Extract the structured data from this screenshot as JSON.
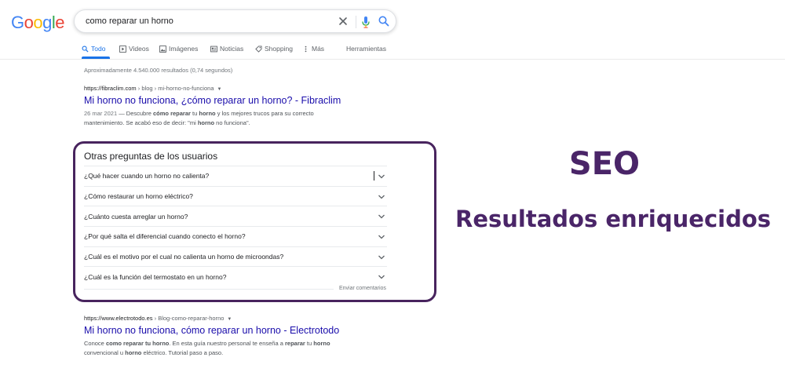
{
  "logo": {
    "letters": [
      "G",
      "o",
      "o",
      "g",
      "l",
      "e"
    ],
    "colors": [
      "#4285F4",
      "#EA4335",
      "#FBBC05",
      "#4285F4",
      "#34A853",
      "#EA4335"
    ]
  },
  "search": {
    "query": "como reparar un horno",
    "icons": [
      "close-icon",
      "microphone-icon",
      "search-icon"
    ]
  },
  "tabs": [
    {
      "label": "Todo",
      "icon": "search-icon",
      "active": true
    },
    {
      "label": "Videos",
      "icon": "play-icon"
    },
    {
      "label": "Imágenes",
      "icon": "image-icon"
    },
    {
      "label": "Noticias",
      "icon": "news-icon"
    },
    {
      "label": "Shopping",
      "icon": "tag-icon"
    },
    {
      "label": "Más",
      "icon": "more-icon"
    },
    {
      "label": "Herramientas"
    }
  ],
  "result_stats": "Aproximadamente 4.540.000 resultados (0,74 segundos)",
  "results": [
    {
      "domain": "https://fibraclim.com",
      "path": " › blog › mi-horno-no-funciona",
      "title": "Mi horno no funciona, ¿cómo reparar un horno? - Fibraclim",
      "date": "26 mar 2021",
      "snippet_1a": " — Descubre ",
      "snippet_1b": "cómo reparar",
      "snippet_1c": " tu ",
      "snippet_1d": "horno",
      "snippet_1e": " y los mejores trucos para su correcto",
      "snippet_2a": "mantenimiento. Se acabó eso de decir: \"mi ",
      "snippet_2b": "horno",
      "snippet_2c": " no funciona\"."
    },
    {
      "domain": "https://www.electrotodo.es",
      "path": " › Blog-como-reparar-horno",
      "title": "Mi horno no funciona, cómo reparar un horno - Electrotodo",
      "snippet_1a": "Conoce ",
      "snippet_1b": "como reparar tu horno",
      "snippet_1c": ". En esta guía nuestro personal te enseña a ",
      "snippet_1d": "reparar",
      "snippet_1e": " tu ",
      "snippet_1f": "horno",
      "snippet_2a": "convencional u ",
      "snippet_2b": "horno",
      "snippet_2c": " eléctrico. Tutorial paso a paso."
    }
  ],
  "people_also_ask": {
    "title": "Otras preguntas de los usuarios",
    "questions": [
      "¿Qué hacer cuando un horno no calienta?",
      "¿Cómo restaurar un horno eléctrico?",
      "¿Cuánto cuesta arreglar un horno?",
      "¿Por qué salta el diferencial cuando conecto el horno?",
      "¿Cuál es el motivo por el cual no calienta un horno de microondas?",
      "¿Cuál es la función del termostato en un horno?"
    ],
    "feedback": "Enviar comentarios",
    "frame_color": "#48245e"
  },
  "overlay": {
    "heading": "SEO",
    "subheading": "Resultados enriquecidos",
    "color": "#4a2568"
  }
}
